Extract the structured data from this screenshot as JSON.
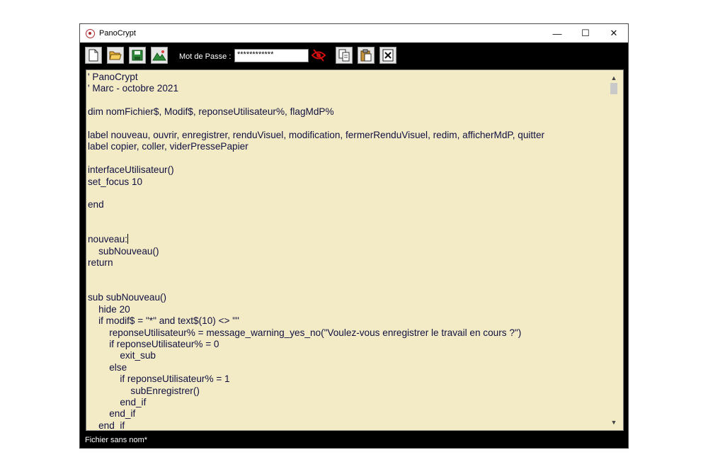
{
  "window": {
    "title": "PanoCrypt",
    "controls": {
      "minimize": "—",
      "maximize": "☐",
      "close": "✕"
    }
  },
  "toolbar": {
    "buttons": [
      {
        "name": "new-file",
        "icon": "new-file-icon"
      },
      {
        "name": "open-folder",
        "icon": "folder-open-icon"
      },
      {
        "name": "save",
        "icon": "floppy-disk-icon"
      },
      {
        "name": "visual-render",
        "icon": "image-icon"
      }
    ],
    "password_label": "Mot de Passe :",
    "password_value": "************",
    "show_password_icon": "eye-crossed-icon",
    "clipboard_buttons": [
      {
        "name": "copy",
        "icon": "copy-icon"
      },
      {
        "name": "paste",
        "icon": "paste-icon"
      },
      {
        "name": "clear-clipboard",
        "icon": "clear-x-icon"
      }
    ],
    "accent": "#d01010"
  },
  "editor": {
    "background": "#f3ebc6",
    "lines": [
      "' PanoCrypt",
      "' Marc - octobre 2021",
      "",
      "dim nomFichier$, Modif$, reponseUtilisateur%, flagMdP%",
      "",
      "label nouveau, ouvrir, enregistrer, renduVisuel, modification, fermerRenduVisuel, redim, afficherMdP, quitter",
      "label copier, coller, viderPressePapier",
      "",
      "interfaceUtilisateur()",
      "set_focus 10",
      "",
      "end",
      "",
      "",
      "nouveau:",
      "    subNouveau()",
      "return",
      "",
      "",
      "sub subNouveau()",
      "    hide 20",
      "    if modif$ = \"*\" and text$(10) <> \"\"",
      "        reponseUtilisateur% = message_warning_yes_no(\"Voulez-vous enregistrer le travail en cours ?\")",
      "        if reponseUtilisateur% = 0",
      "            exit_sub",
      "        else",
      "            if reponseUtilisateur% = 1",
      "                subEnregistrer()",
      "            end_if",
      "        end_if",
      "    end_if"
    ],
    "caret_line": 14
  },
  "status": {
    "text": "Fichier sans nom*"
  }
}
